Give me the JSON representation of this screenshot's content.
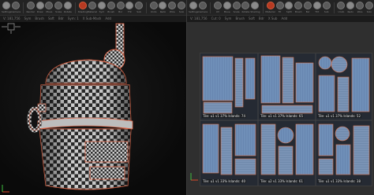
{
  "left_toolbar": {
    "items": [
      {
        "label": "Settings"
      },
      {
        "label": "Camera"
      },
      {
        "label": "Render"
      },
      {
        "label": "Draw"
      },
      {
        "label": "Move"
      },
      {
        "label": "Scale"
      },
      {
        "label": "Rotate"
      },
      {
        "label": "Shading"
      },
      {
        "label": "Material"
      },
      {
        "label": "Sym"
      },
      {
        "label": "Brush"
      },
      {
        "label": "Bvl"
      },
      {
        "label": "Tht"
      },
      {
        "label": "Sub"
      },
      {
        "label": "Undo"
      },
      {
        "label": "Redo"
      },
      {
        "label": "Wire"
      },
      {
        "label": "Solo"
      }
    ],
    "sub_items": [
      "V: 181,756",
      "Sym",
      "Brush",
      "Soft",
      "Bdr",
      "Sym: 1",
      "X Sub-Mash",
      "Add"
    ]
  },
  "right_toolbar": {
    "items": [
      {
        "label": "Settings"
      },
      {
        "label": "Camera"
      },
      {
        "label": "UV"
      },
      {
        "label": "Move"
      },
      {
        "label": "Scale"
      },
      {
        "label": "Rotate"
      },
      {
        "label": "Shading"
      },
      {
        "label": "Material"
      },
      {
        "label": "Fit"
      },
      {
        "label": "Spltt"
      },
      {
        "label": "Brush"
      },
      {
        "label": "Bvl"
      },
      {
        "label": "Tht"
      },
      {
        "label": "Sub"
      },
      {
        "label": "Undo"
      },
      {
        "label": "Redo"
      },
      {
        "label": "Wire"
      },
      {
        "label": "Solo"
      }
    ],
    "sub_items": [
      "V: 181,756",
      "Cut: 0",
      "Sym",
      "Brush",
      "Soft",
      "Bdr",
      "X Sub",
      "Add"
    ]
  },
  "uv_tiles": [
    {
      "label": "Tile: u1 v1 37% Islands: 74"
    },
    {
      "label": "Tile: u1 v1 37% Islands: 65"
    },
    {
      "label": "Tile: u1 v1 37% Islands: 52"
    },
    {
      "label": "Tile: u1 v1 33% Islands: 40"
    },
    {
      "label": "Tile: u2 v1 33% Islands: 61"
    },
    {
      "label": "Tile: u1 v1 33% Islands: 38"
    }
  ],
  "colors": {
    "accent": "#e0684a",
    "checker_dark": "#2a2a2a",
    "checker_light": "#d6d6d6",
    "uv_island": "#6f8fb8",
    "uv_edge": "#e07a55"
  },
  "icons": [
    "axis-gizmo-icon",
    "view-cube-icon",
    "toolbar-tool-icon"
  ]
}
